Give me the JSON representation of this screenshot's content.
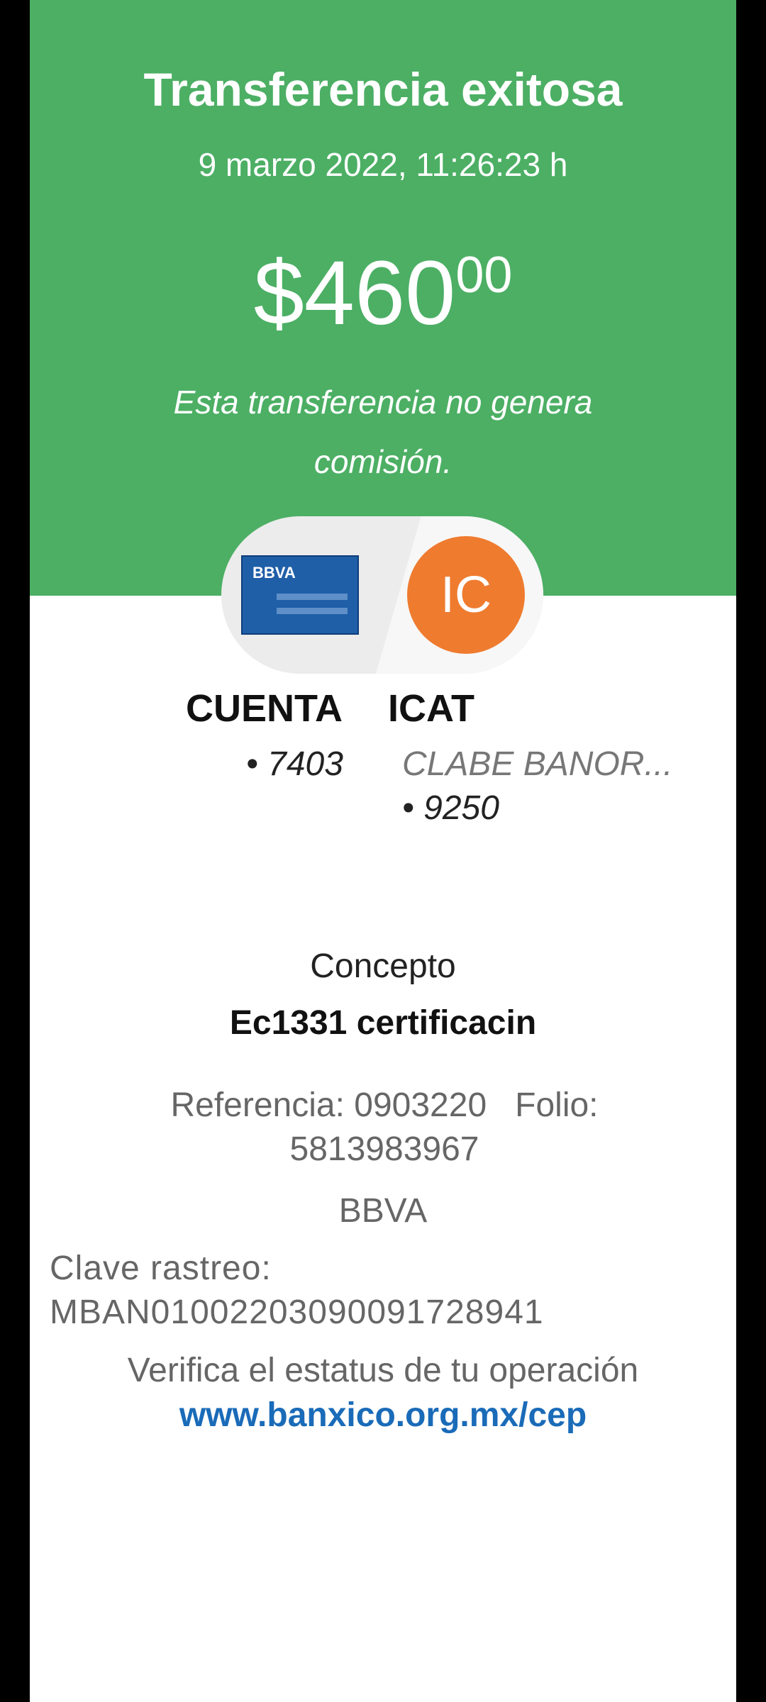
{
  "header": {
    "title": "Transferencia exitosa",
    "datetime": "9 marzo 2022, 11:26:23 h",
    "amount_whole": "$460",
    "amount_cents": "00",
    "fee_note": "Esta transferencia no genera comisión."
  },
  "origin": {
    "bank_logo": "BBVA",
    "name": "CUENTA",
    "account_suffix": "• 7403"
  },
  "destination": {
    "initials": "IC",
    "name": "ICAT",
    "bank_label": "CLABE BANOR...",
    "account_suffix": "• 9250"
  },
  "details": {
    "concept_label": "Concepto",
    "concept_value": "Ec1331 certificacin",
    "reference_line1": "Referencia: 0903220   Folio:",
    "reference_line2": "5813983967",
    "bank": "BBVA",
    "trace_label": "Clave rastreo:",
    "trace_value": "MBAN01002203090091728941",
    "verify_text": "Verifica el estatus de tu operación",
    "verify_link": "www.banxico.org.mx/cep"
  },
  "colors": {
    "header_green": "#4caf64",
    "avatar_orange": "#ef7b2f",
    "bbva_blue": "#1f5fa8",
    "link_blue": "#1a6bb8"
  }
}
